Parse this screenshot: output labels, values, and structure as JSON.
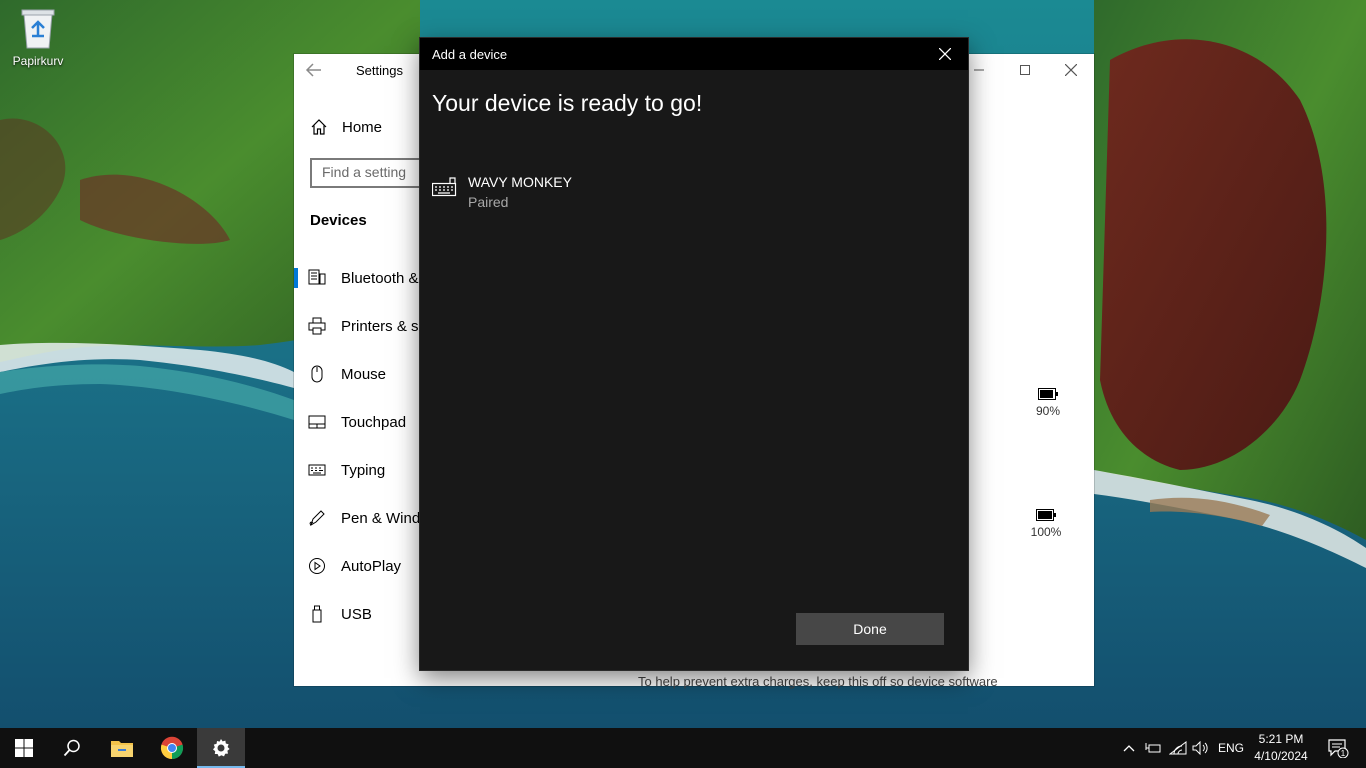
{
  "desktop": {
    "icons": [
      {
        "label": "Papirkurv",
        "icon": "recycle-bin-icon"
      }
    ]
  },
  "settings": {
    "title": "Settings",
    "home_label": "Home",
    "search_placeholder": "Find a setting",
    "section_label": "Devices",
    "nav_items": [
      {
        "label": "Bluetooth & other devices",
        "icon": "bluetooth-devices-icon",
        "active": true
      },
      {
        "label": "Printers & scanners",
        "icon": "printer-icon"
      },
      {
        "label": "Mouse",
        "icon": "mouse-icon"
      },
      {
        "label": "Touchpad",
        "icon": "touchpad-icon"
      },
      {
        "label": "Typing",
        "icon": "keyboard-icon"
      },
      {
        "label": "Pen & Windows Ink",
        "icon": "pen-icon"
      },
      {
        "label": "AutoPlay",
        "icon": "autoplay-icon"
      },
      {
        "label": "USB",
        "icon": "usb-icon"
      }
    ],
    "batteries": [
      {
        "label": "90%",
        "icon": "battery-icon",
        "level": 0.9
      },
      {
        "label": "100%",
        "icon": "battery-icon",
        "level": 1.0
      }
    ],
    "bottom_text": "To help prevent extra charges, keep this off so device software"
  },
  "dialog": {
    "title": "Add a device",
    "heading": "Your device is ready to go!",
    "device": {
      "name": "WAVY MONKEY",
      "status": "Paired",
      "icon": "keyboard-icon"
    },
    "done_label": "Done"
  },
  "taskbar": {
    "language": "ENG",
    "time": "5:21 PM",
    "date": "4/10/2024",
    "notification_count": "1",
    "accent": "#76b9ed"
  }
}
